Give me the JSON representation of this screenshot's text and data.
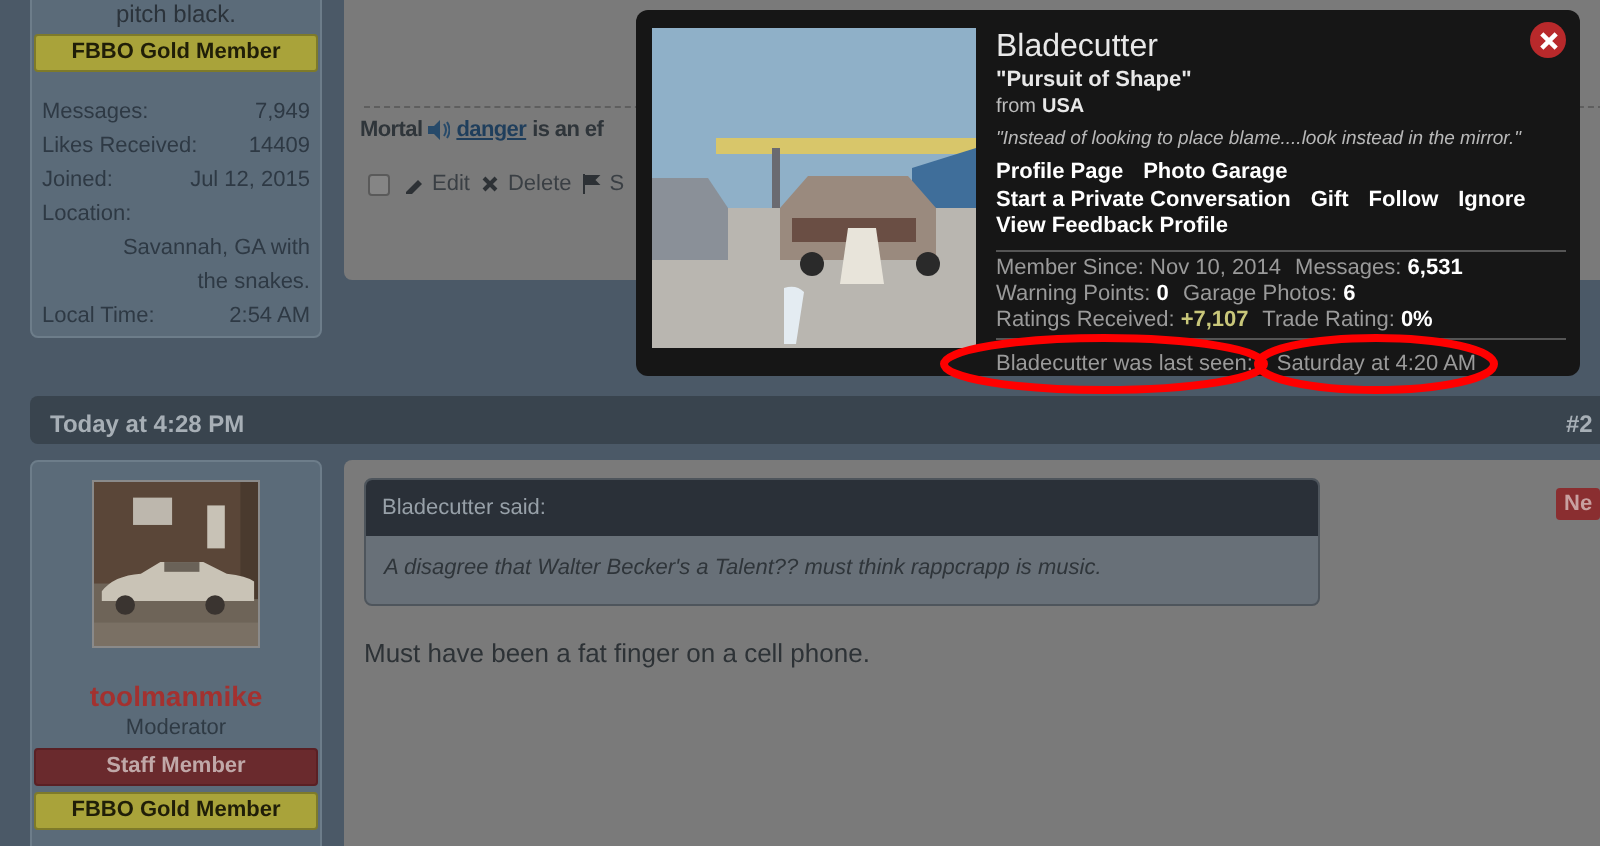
{
  "previous_post": {
    "user_panel": {
      "title_tail": "pitch black.",
      "banners": [
        {
          "kind": "gold",
          "label": "FBBO Gold Member"
        }
      ],
      "stats": [
        {
          "label": "Messages:",
          "value": "7,949"
        },
        {
          "label": "Likes Received:",
          "value": "14409"
        },
        {
          "label": "Joined:",
          "value": "Jul 12, 2015"
        },
        {
          "label": "Location:",
          "value": "Savannah, GA with the snakes."
        },
        {
          "label": "Local Time:",
          "value": "2:54 AM"
        }
      ]
    },
    "signature": {
      "before": "Mortal",
      "link": "danger",
      "after": "is an ef"
    },
    "actions": [
      {
        "kind": "checkbox",
        "checked": false
      },
      {
        "kind": "edit",
        "label": "Edit"
      },
      {
        "kind": "delete",
        "label": "Delete"
      },
      {
        "kind": "spam",
        "label": "S"
      }
    ]
  },
  "post": {
    "date": "Today at 4:28 PM",
    "number": "#2",
    "new_badge": "Ne",
    "user_panel": {
      "username": "toolmanmike",
      "role": "Moderator",
      "banners": [
        {
          "kind": "staff",
          "label": "Staff Member"
        },
        {
          "kind": "gold",
          "label": "FBBO Gold Member"
        }
      ]
    },
    "quote": {
      "author": "Bladecutter said:",
      "text": "A disagree that Walter Becker's a Talent?? must think rappcrapp is music."
    },
    "message": "Must have been a fat finger on a cell phone."
  },
  "member_card": {
    "name": "Bladecutter",
    "title": "\"Pursuit of Shape\"",
    "from_label": "from",
    "from_value": "USA",
    "signature": "\"Instead of looking to place blame....look instead in the mirror.\"",
    "links": [
      "Profile Page",
      "Photo Garage",
      "Start a Private Conversation",
      "Gift",
      "Follow",
      "Ignore",
      "View Feedback Profile"
    ],
    "stats": [
      {
        "label": "Member Since:",
        "value": "Nov 10, 2014",
        "kind": "plain"
      },
      {
        "label": "Messages:",
        "value": "6,531",
        "kind": "bold"
      },
      {
        "label": "Warning Points:",
        "value": "0",
        "kind": "bold"
      },
      {
        "label": "Garage Photos:",
        "value": "6",
        "kind": "bold"
      },
      {
        "label": "Ratings Received:",
        "value": "+7,107",
        "kind": "positive"
      },
      {
        "label": "Trade Rating:",
        "value": "0%",
        "kind": "bold"
      }
    ],
    "last_seen_label": "Bladecutter was last seen:",
    "last_seen_value": "Saturday at 4:20 AM"
  }
}
